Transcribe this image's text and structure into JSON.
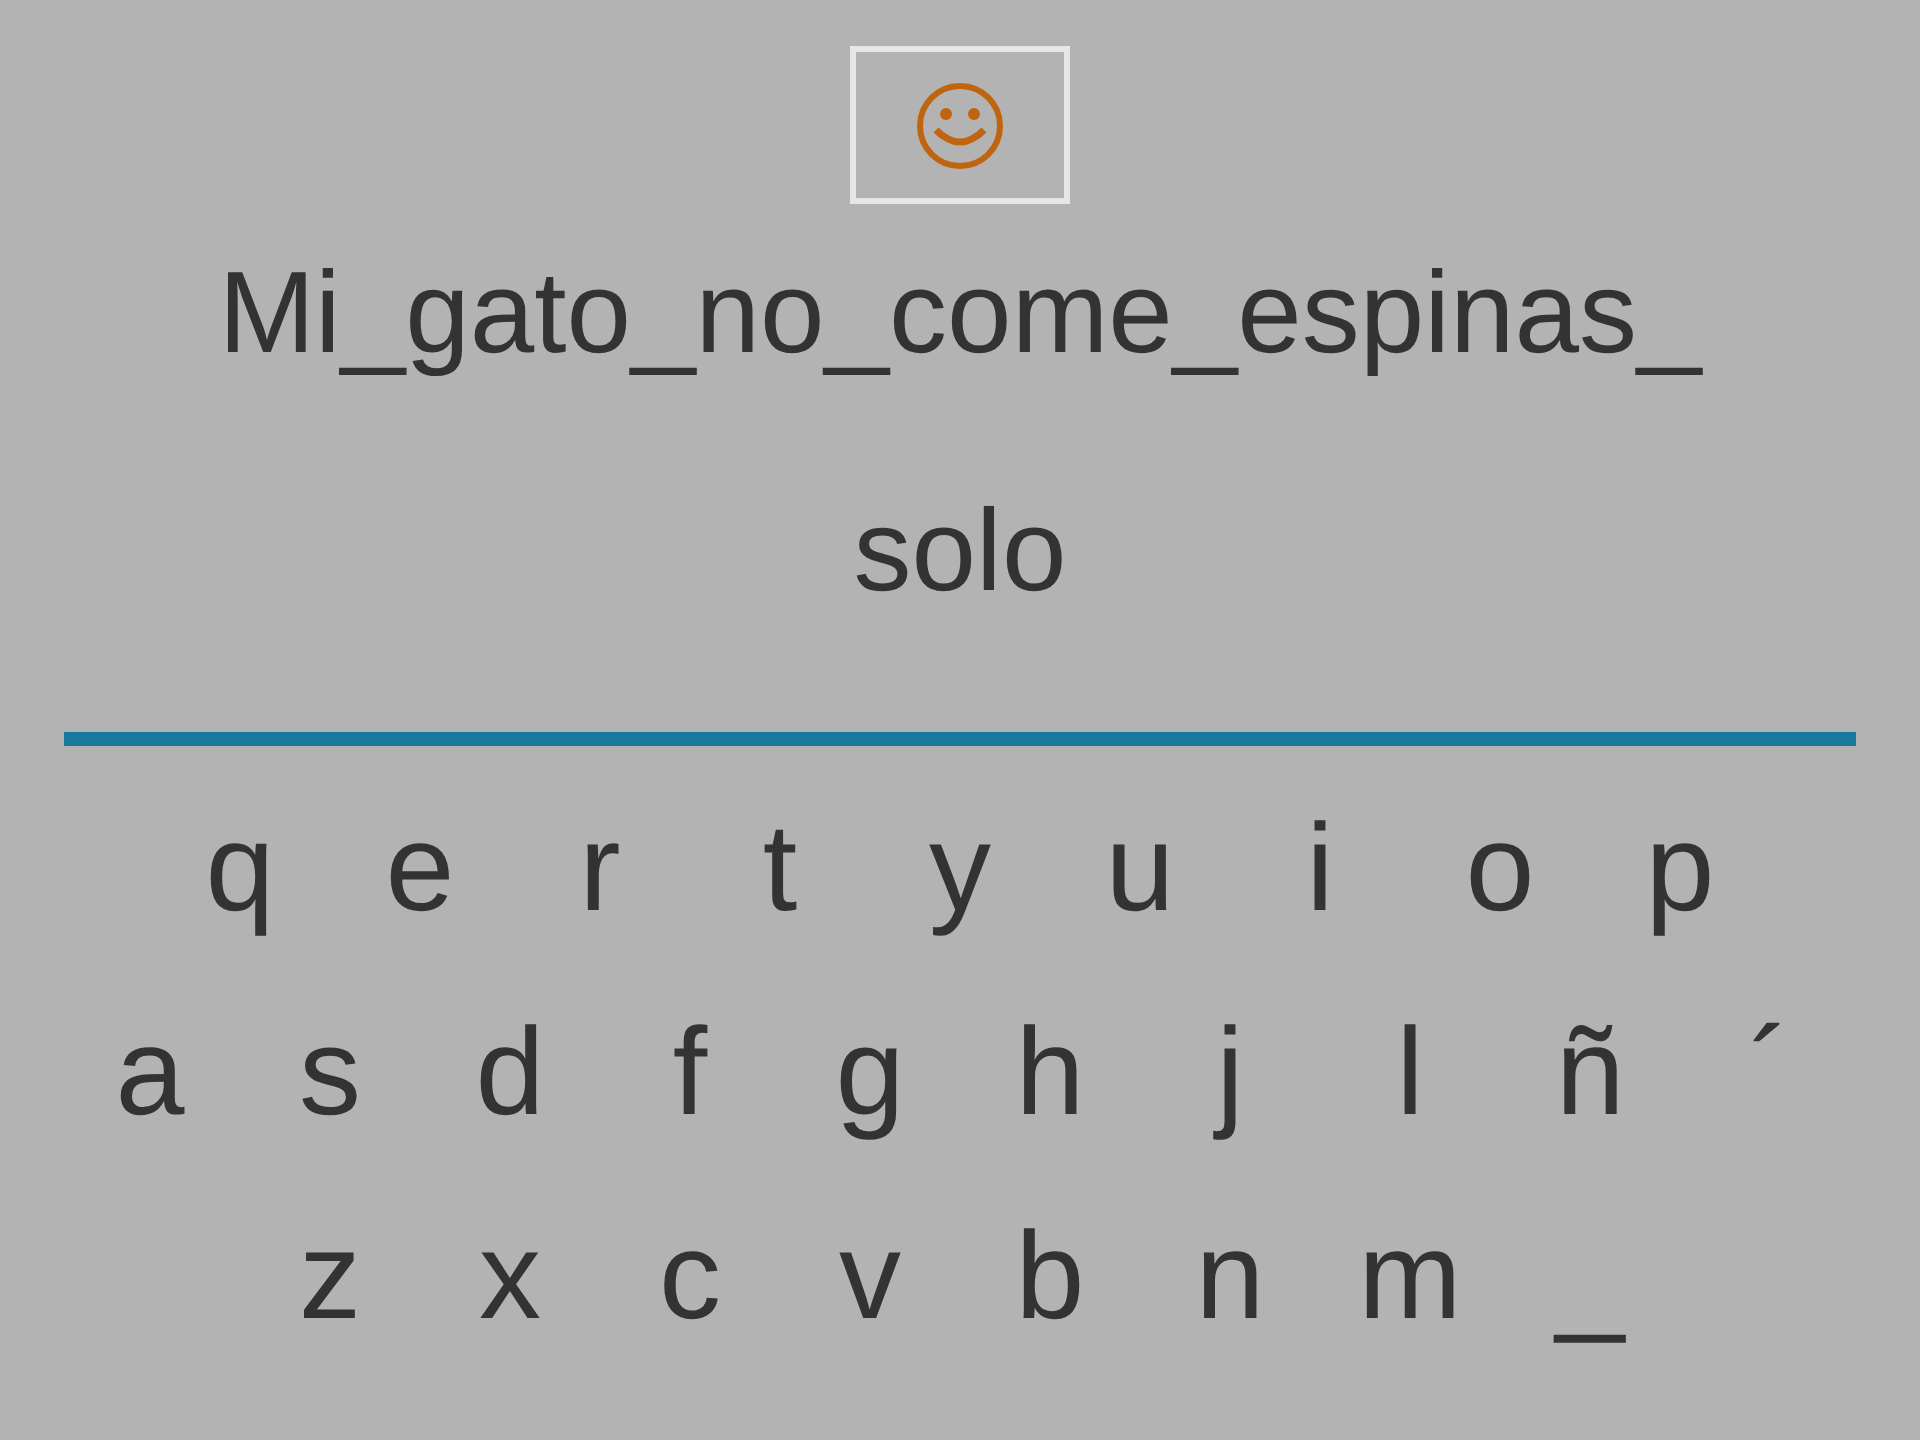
{
  "phrase": [
    "Mi_gato_no_come_espinas_",
    "solo"
  ],
  "keyboard": {
    "rows": [
      [
        "q",
        "e",
        "r",
        "t",
        "y",
        "u",
        "i",
        "o",
        "p"
      ],
      [
        "a",
        "s",
        "d",
        "f",
        "g",
        "h",
        "j",
        "l",
        "ñ",
        "´"
      ],
      [
        "z",
        "x",
        "c",
        "v",
        "b",
        "n",
        "m",
        "_"
      ]
    ]
  }
}
